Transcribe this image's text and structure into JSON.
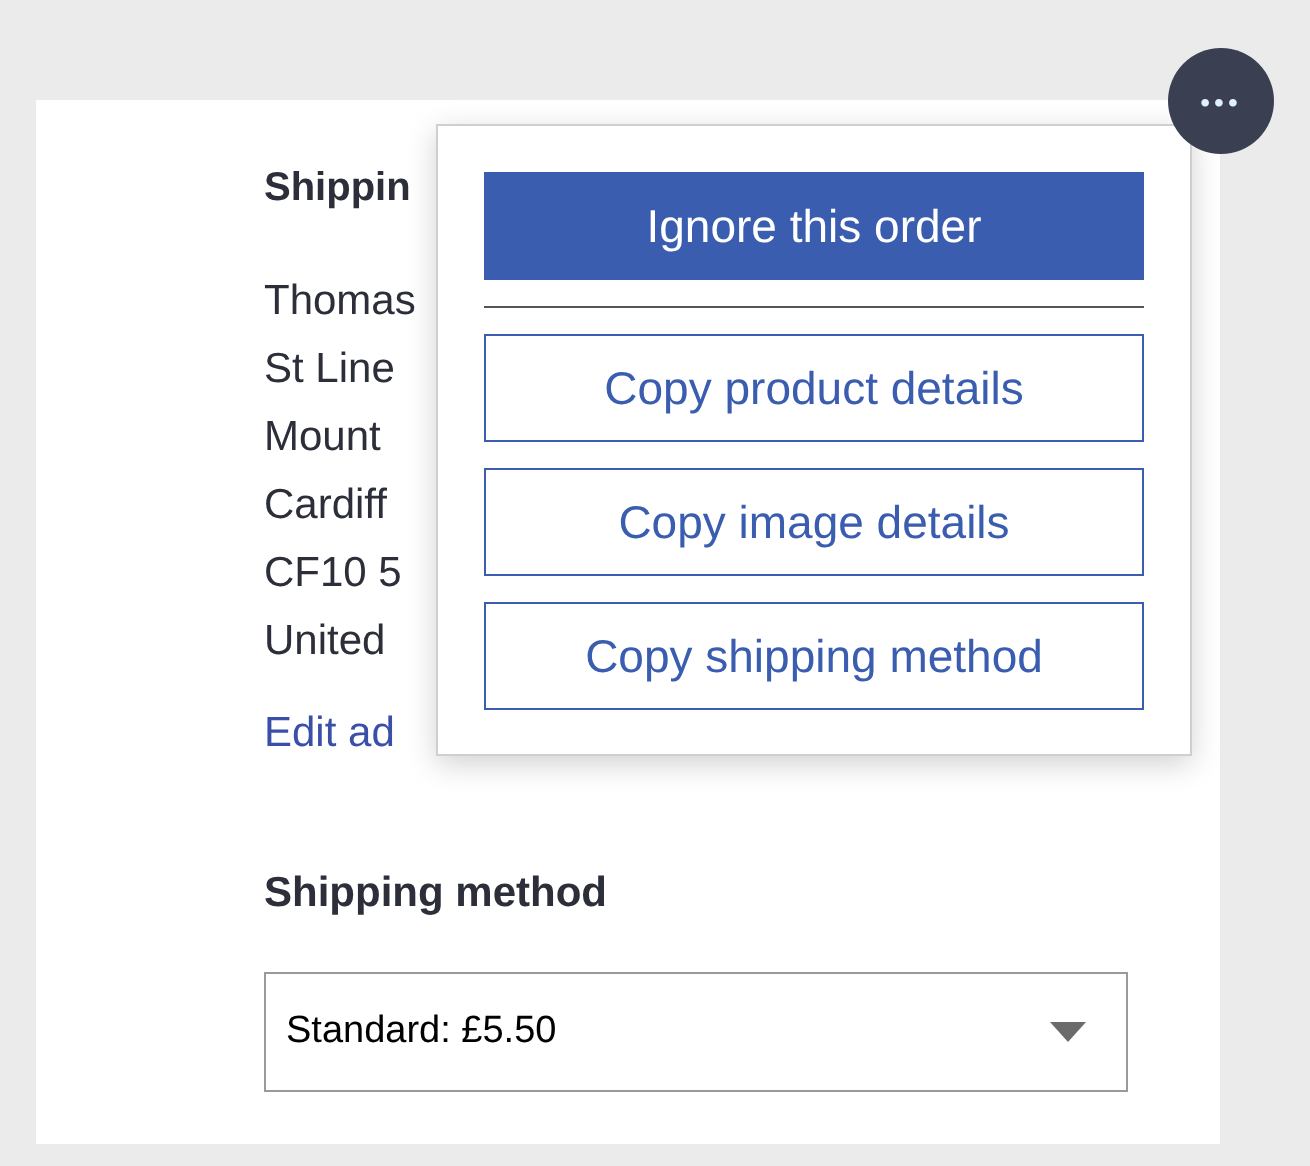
{
  "address": {
    "heading": "Shippin",
    "lines": [
      "Thomas",
      "St Line",
      "Mount",
      "Cardiff",
      "CF10 5",
      "United"
    ],
    "edit_link": "Edit ad"
  },
  "more_button": {
    "label": "•••",
    "expanded": true
  },
  "menu": {
    "items": [
      {
        "kind": "primary",
        "label": "Ignore this order"
      },
      {
        "kind": "divider"
      },
      {
        "kind": "outline",
        "label": "Copy product details"
      },
      {
        "kind": "outline",
        "label": "Copy image details"
      },
      {
        "kind": "outline",
        "label": "Copy shipping method"
      }
    ]
  },
  "shipping_method": {
    "heading": "Shipping method",
    "value": "Standard: £5.50"
  }
}
